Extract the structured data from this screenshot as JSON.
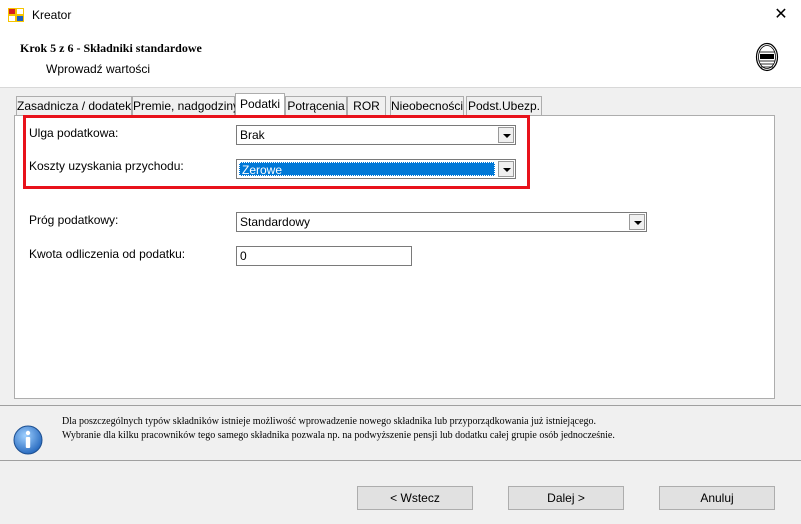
{
  "window": {
    "title": "Kreator",
    "close_glyph": "✕"
  },
  "header": {
    "step_title": "Krok 5 z 6 - Składniki standardowe",
    "step_subtitle": "Wprowadź wartości"
  },
  "tabs": [
    {
      "label": "Zasadnicza / dodatek",
      "active": false
    },
    {
      "label": "Premie, nadgodziny",
      "active": false
    },
    {
      "label": "Podatki",
      "active": true
    },
    {
      "label": "Potrącenia",
      "active": false
    },
    {
      "label": "ROR",
      "active": false
    },
    {
      "label": "Nieobecności",
      "active": false
    },
    {
      "label": "Podst.Ubezp.",
      "active": false
    }
  ],
  "form": {
    "ulga": {
      "label": "Ulga podatkowa:",
      "value": "Brak"
    },
    "koszty": {
      "label": "Koszty uzyskania przychodu:",
      "value": "Zerowe"
    },
    "prog": {
      "label": "Próg podatkowy:",
      "value": "Standardowy"
    },
    "kwota": {
      "label": "Kwota odliczenia od podatku:",
      "value": "0"
    }
  },
  "info": {
    "line1": "Dla poszczególnych typów składników istnieje możliwość wprowadzenie nowego składnika lub przyporządkowania już istniejącego.",
    "line2": "Wybranie dla kilku pracowników tego samego składnika pozwala np. na podwyższenie pensji lub dodatku całej grupie osób jednocześnie."
  },
  "buttons": {
    "back": "< Wstecz",
    "next": "Dalej >",
    "cancel": "Anuluj"
  },
  "colors": {
    "highlight": "#e8121b",
    "selection": "#0078d7"
  }
}
